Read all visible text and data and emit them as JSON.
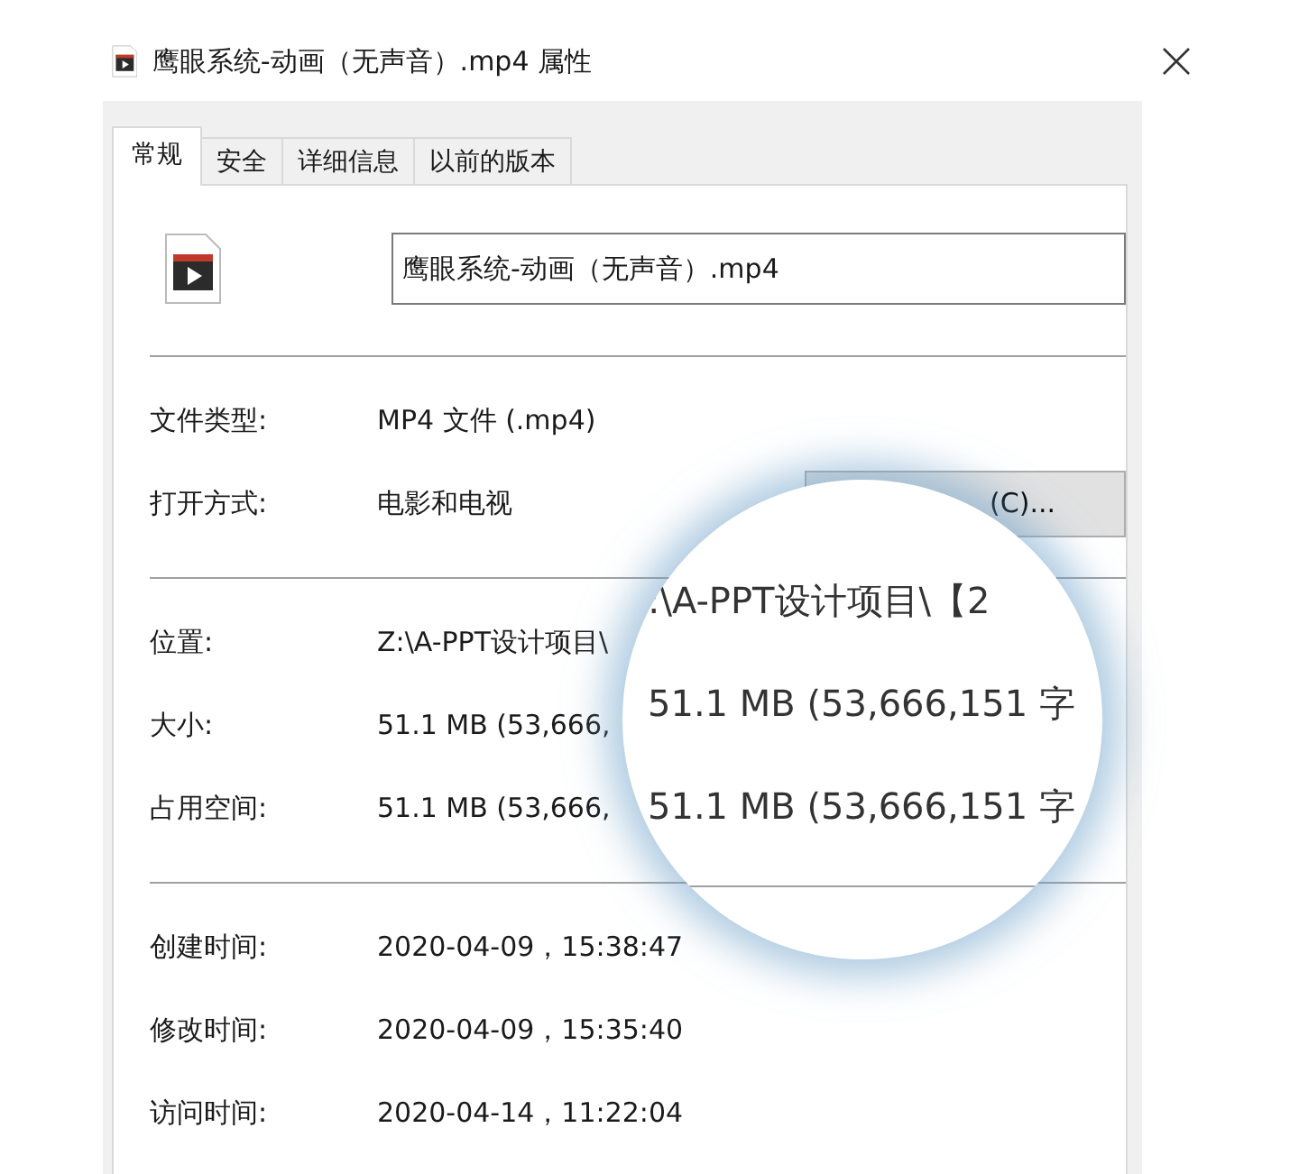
{
  "window": {
    "title": "鹰眼系统-动画（无声音）.mp4 属性"
  },
  "tabs": [
    {
      "label": "常规",
      "selected": true
    },
    {
      "label": "安全",
      "selected": false
    },
    {
      "label": "详细信息",
      "selected": false
    },
    {
      "label": "以前的版本",
      "selected": false
    }
  ],
  "file_name": "鹰眼系统-动画（无声音）.mp4",
  "sections": [
    {
      "rows": [
        {
          "label": "文件类型:",
          "value": "MP4 文件 (.mp4)"
        },
        {
          "label": "打开方式:",
          "value": "电影和电视",
          "button": "(C)..."
        }
      ]
    },
    {
      "rows": [
        {
          "label": "位置:",
          "value": "Z:\\A-PPT设计项目\\"
        },
        {
          "label": "大小:",
          "value": "51.1 MB (53,666,"
        },
        {
          "label": "占用空间:",
          "value": "51.1 MB (53,666,"
        }
      ]
    },
    {
      "rows": [
        {
          "label": "创建时间:",
          "value": "2020-04-09，15:38:47"
        },
        {
          "label": "修改时间:",
          "value": "2020-04-09，15:35:40"
        },
        {
          "label": "访问时间:",
          "value": "2020-04-14，11:22:04"
        }
      ]
    }
  ],
  "magnifier": {
    "lines": [
      ":\\A-PPT设计项目\\【2",
      "51.1 MB (53,666,151 字",
      "51.1 MB (53,666,151 字"
    ]
  }
}
